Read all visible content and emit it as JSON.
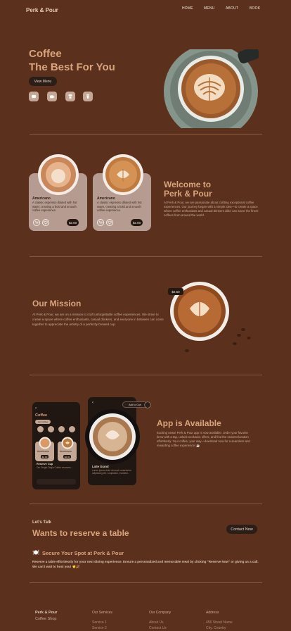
{
  "nav": {
    "brand": "Perk & Pour",
    "links": [
      "HOME",
      "MENU",
      "ABOUT",
      "BOOK"
    ]
  },
  "hero": {
    "title_line1": "Coffee",
    "title_line2": "The Best For You",
    "cta": "View Menu",
    "icons": [
      "coffee-beans-icon",
      "coffee-cup-icon",
      "coffee-machine-icon",
      "takeaway-cup-icon"
    ]
  },
  "welcome": {
    "title_line1": "Welcome to",
    "title_line2": "Perk & Pour",
    "text": "At Perk & Pour, we are passionate about crafting exceptional coffee experiences. Our journey began with a simple idea—to create a space where coffee enthusiasts and casual drinkers alike can savor the finest coffees from around the world.",
    "cards": [
      {
        "name": "Americano",
        "desc": "A classic espresso diluted with hot water, creating a bold and smooth coffee experience.",
        "price": "$2.00"
      },
      {
        "name": "Americano",
        "desc": "A classic espresso diluted with hot water, creating a bold and smooth coffee experience.",
        "price": "$2.00"
      }
    ]
  },
  "mission": {
    "title": "Our Mission",
    "text": "At Perk & Pour, we are on a mission to craft unforgettable coffee experiences. We strive to create a space where coffee enthusiasts, casual drinkers, and everyone in between can come together to appreciate the artistry of a perfectly brewed cup.",
    "price_tag": "$2.50"
  },
  "app": {
    "title": "App is Available",
    "text": "Exciting news! Perk & Pour app is now available. Order your favorite brew with a tap, unlock exclusive offers, and find the nearest location effortlessly. Your coffee, your way—download now for a seamless and rewarding coffee experience! ☕",
    "phone1": {
      "title": "Coffee",
      "chip": "Hot Coffee",
      "items": [
        {
          "name": "Americano",
          "price": "$2.00"
        },
        {
          "name": "Americano",
          "price": "$2.00"
        }
      ],
      "promo_title": "Reserve Cup",
      "promo_text": "Our Single-Origin Coffee uncovers ..."
    },
    "phone2": {
      "add_to_cart": "Add to Cart",
      "name": "Latte Grand",
      "desc": "Lorem ipsum dolor sit amet consectetur adipisicing elit, voluptatem, incididul..."
    }
  },
  "reserve": {
    "eyebrow": "Let's Talk",
    "title": "Wants to reserve a table",
    "button": "Contact Now",
    "heading_icon": "🍽️",
    "heading": "Secure Your Spot at Perk & Pour",
    "text": "Reserve a table effortlessly for your next dining experience. Ensure a personalized and memorable meal by clicking \"Reserve Now\" or giving us a call. We can't wait to host you! ⭐️🎉"
  },
  "footer": {
    "brand_line1": "Perk & Pour",
    "brand_line2": "Coffee Shop",
    "services_title": "Our Services",
    "services": [
      "Service 1",
      "Service 2"
    ],
    "company_title": "Our Company",
    "company": [
      "About Us",
      "Contact Us"
    ],
    "address_title": "Address",
    "address": [
      "456 Street Name",
      "City, Country"
    ]
  },
  "colors": {
    "background": "#5b311d",
    "accent": "#d9a47c",
    "card": "#b69c90",
    "dark": "#2b1d17"
  }
}
